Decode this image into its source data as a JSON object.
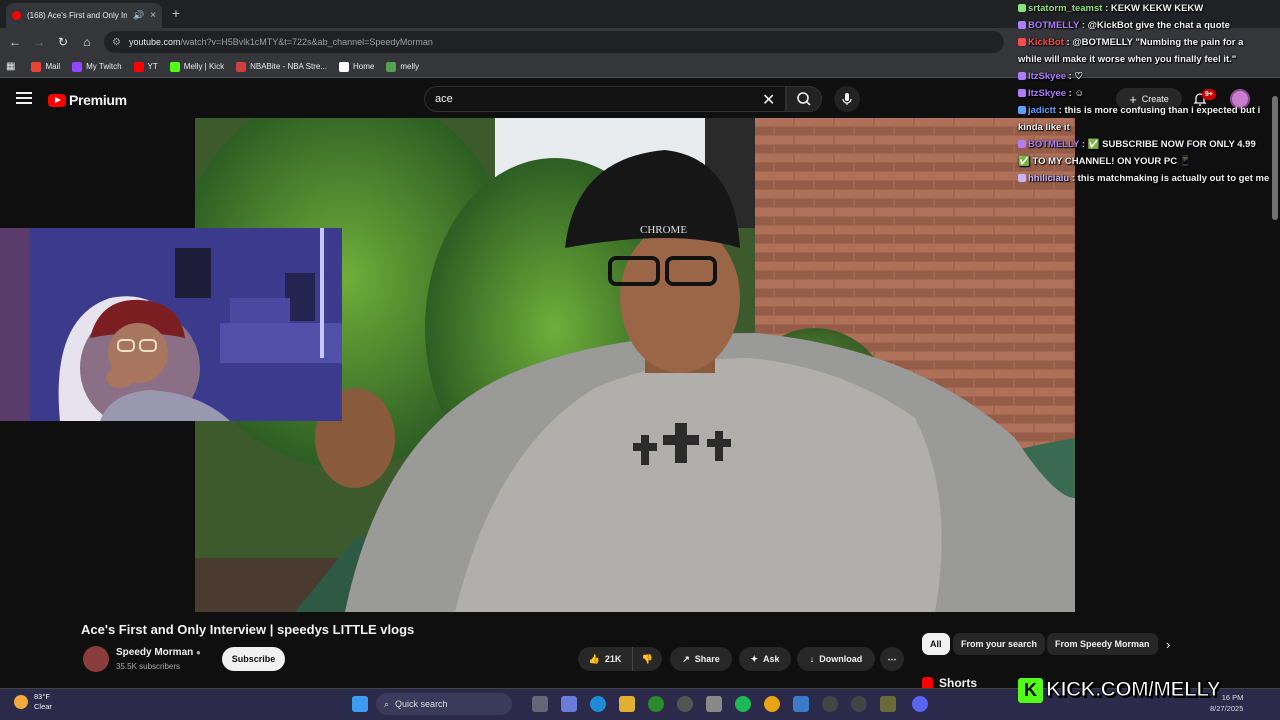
{
  "browser": {
    "tab": {
      "title": "(168) Ace's First and Only In",
      "close": "×"
    },
    "new_tab": "+",
    "url": {
      "domain": "youtube.com",
      "path": "/watch?v=H5Bvlk1cMTY&t=722s&ab_channel=SpeedyMorman"
    },
    "bookmarks": [
      {
        "label": "Mail",
        "icon": "gmail-icon",
        "color": "#ea4335"
      },
      {
        "label": "My Twitch",
        "icon": "twitch-icon",
        "color": "#9146ff"
      },
      {
        "label": "YT",
        "icon": "youtube-icon",
        "color": "#ff0000"
      },
      {
        "label": "Melly | Kick",
        "icon": "kick-icon",
        "color": "#53fc18"
      },
      {
        "label": "NBABite - NBA Stre...",
        "icon": "nbabite-icon",
        "color": "#d23c3c"
      },
      {
        "label": "Home",
        "icon": "x-icon",
        "color": "#ffffff"
      },
      {
        "label": "melly",
        "icon": "bookmark-icon",
        "color": "#53a050"
      }
    ]
  },
  "youtube": {
    "logo_text": "Premium",
    "search_value": "ace",
    "create_label": "Create",
    "notifications": "9+"
  },
  "video": {
    "title": "Ace's First and Only Interview | speedys LITTLE vlogs",
    "channel": "Speedy Morman",
    "subscribers": "35.5K subscribers",
    "subscribe_label": "Subscribe",
    "likes": "21K",
    "share_label": "Share",
    "ask_label": "Ask",
    "download_label": "Download"
  },
  "filter_chips": [
    "All",
    "From your search",
    "From Speedy Morman"
  ],
  "shorts_label": "Shorts",
  "chat": [
    {
      "user": "srtatorm_teamst",
      "user_color": "#8ee07a",
      "message": "KEKW KEKW KEKW"
    },
    {
      "user": "BOTMELLY",
      "user_color": "#b07cff",
      "message": "@KickBot give the chat a quote"
    },
    {
      "user": "KickBot",
      "user_color": "#ff4a4a",
      "message": "@BOTMELLY \"Numbing the pain for a"
    },
    {
      "user": "",
      "user_color": "#ffffff",
      "message": "while will make it worse when you finally feel it.\""
    },
    {
      "user": "ItzSkyee",
      "user_color": "#b07cff",
      "message": "♡"
    },
    {
      "user": "ItzSkyee",
      "user_color": "#b07cff",
      "message": "☺"
    },
    {
      "user": "jadictt",
      "user_color": "#5aa0ff",
      "message": "this is more confusing than i expected but i"
    },
    {
      "user": "",
      "user_color": "#ffffff",
      "message": "kinda like it"
    },
    {
      "user": "BOTMELLY",
      "user_color": "#b07cff",
      "message": "✅ SUBSCRIBE NOW FOR ONLY 4.99"
    },
    {
      "user": "",
      "user_color": "#ffffff",
      "message": "✅ TO MY CHANNEL! ON YOUR PC 📱"
    },
    {
      "user": "hhiliciaiu",
      "user_color": "#c8b4ff",
      "message": "this matchmaking is actually out to get me"
    }
  ],
  "taskbar": {
    "weather_temp": "83°F",
    "weather_desc": "Clear",
    "search_label": "Quick search",
    "time": "16 PM",
    "date": "8/27/2025"
  },
  "kick_banner": {
    "logo": "K",
    "text": "KICK.COM/MELLY"
  }
}
